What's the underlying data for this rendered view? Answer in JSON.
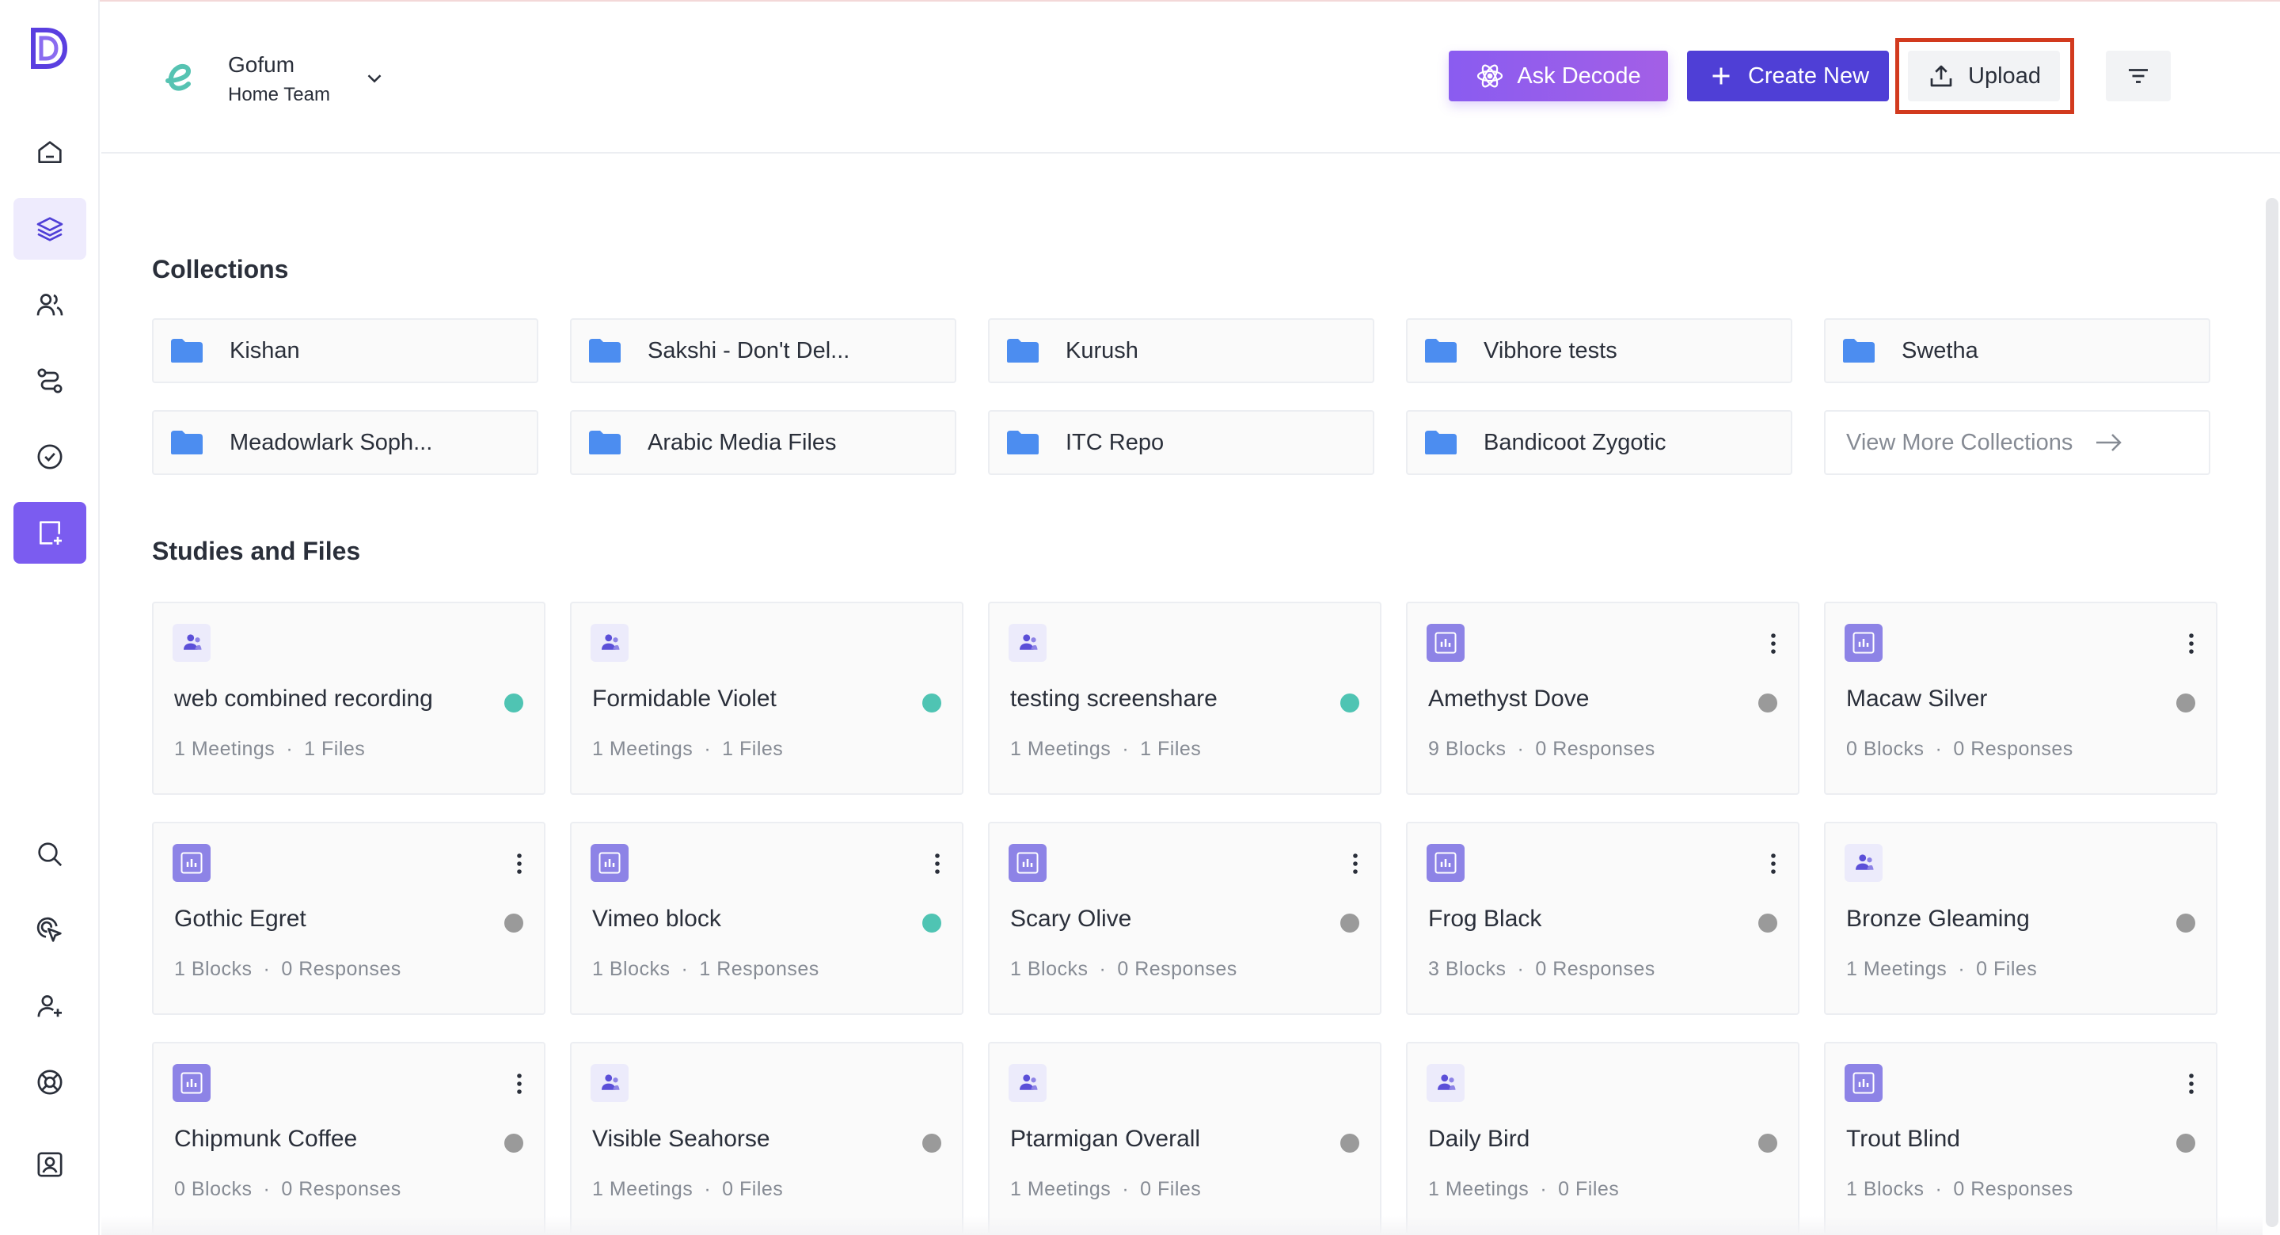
{
  "colors": {
    "accent": "#7b5cf0",
    "create": "#4f3fd6",
    "highlight": "#d23a1e",
    "status_active": "#4fc4b3",
    "status_inactive": "#9a9a9a",
    "folder": "#4c8df0"
  },
  "sidebar": {
    "logo_icon": "decode-logo-icon",
    "items": [
      {
        "icon": "home-icon"
      },
      {
        "icon": "layers-icon"
      },
      {
        "icon": "users-icon"
      },
      {
        "icon": "route-icon"
      },
      {
        "icon": "check-badge-icon"
      },
      {
        "icon": "add-file-icon"
      },
      {
        "icon": "search-icon"
      },
      {
        "icon": "pointer-click-icon"
      },
      {
        "icon": "add-user-icon"
      },
      {
        "icon": "lifebuoy-icon"
      },
      {
        "icon": "profile-icon"
      }
    ]
  },
  "header": {
    "team_name": "Gofum",
    "team_sub": "Home Team",
    "ask_label": "Ask Decode",
    "create_label": "Create New",
    "upload_label": "Upload"
  },
  "collections": {
    "title": "Collections",
    "items": [
      {
        "name": "Kishan"
      },
      {
        "name": "Sakshi - Don't Del..."
      },
      {
        "name": "Kurush"
      },
      {
        "name": "Vibhore tests"
      },
      {
        "name": "Swetha"
      },
      {
        "name": "Meadowlark Soph..."
      },
      {
        "name": "Arabic Media Files"
      },
      {
        "name": "ITC Repo"
      },
      {
        "name": "Bandicoot Zygotic"
      }
    ],
    "view_more": "View More Collections"
  },
  "studies": {
    "title": "Studies and Files",
    "items": [
      {
        "name": "web combined recording",
        "type": "study",
        "status": "active",
        "a": "1",
        "a_label": "Meetings",
        "b": "1",
        "b_label": "Files",
        "menu": false
      },
      {
        "name": "Formidable Violet",
        "type": "study",
        "status": "active",
        "a": "1",
        "a_label": "Meetings",
        "b": "1",
        "b_label": "Files",
        "menu": false
      },
      {
        "name": "testing screenshare",
        "type": "study",
        "status": "active",
        "a": "1",
        "a_label": "Meetings",
        "b": "1",
        "b_label": "Files",
        "menu": false
      },
      {
        "name": "Amethyst Dove",
        "type": "file",
        "status": "inactive",
        "a": "9",
        "a_label": "Blocks",
        "b": "0",
        "b_label": "Responses",
        "menu": true
      },
      {
        "name": "Macaw Silver",
        "type": "file",
        "status": "inactive",
        "a": "0",
        "a_label": "Blocks",
        "b": "0",
        "b_label": "Responses",
        "menu": true
      },
      {
        "name": "Gothic Egret",
        "type": "file",
        "status": "inactive",
        "a": "1",
        "a_label": "Blocks",
        "b": "0",
        "b_label": "Responses",
        "menu": true
      },
      {
        "name": "Vimeo block",
        "type": "file",
        "status": "active",
        "a": "1",
        "a_label": "Blocks",
        "b": "1",
        "b_label": "Responses",
        "menu": true
      },
      {
        "name": "Scary Olive",
        "type": "file",
        "status": "inactive",
        "a": "1",
        "a_label": "Blocks",
        "b": "0",
        "b_label": "Responses",
        "menu": true
      },
      {
        "name": "Frog Black",
        "type": "file",
        "status": "inactive",
        "a": "3",
        "a_label": "Blocks",
        "b": "0",
        "b_label": "Responses",
        "menu": true
      },
      {
        "name": "Bronze Gleaming",
        "type": "study",
        "status": "inactive",
        "a": "1",
        "a_label": "Meetings",
        "b": "0",
        "b_label": "Files",
        "menu": false
      },
      {
        "name": "Chipmunk Coffee",
        "type": "file",
        "status": "inactive",
        "a": "0",
        "a_label": "Blocks",
        "b": "0",
        "b_label": "Responses",
        "menu": true
      },
      {
        "name": "Visible Seahorse",
        "type": "study",
        "status": "inactive",
        "a": "1",
        "a_label": "Meetings",
        "b": "0",
        "b_label": "Files",
        "menu": false
      },
      {
        "name": "Ptarmigan Overall",
        "type": "study",
        "status": "inactive",
        "a": "1",
        "a_label": "Meetings",
        "b": "0",
        "b_label": "Files",
        "menu": false
      },
      {
        "name": "Daily Bird",
        "type": "study",
        "status": "inactive",
        "a": "1",
        "a_label": "Meetings",
        "b": "0",
        "b_label": "Files",
        "menu": false
      },
      {
        "name": "Trout Blind",
        "type": "file",
        "status": "inactive",
        "a": "1",
        "a_label": "Blocks",
        "b": "0",
        "b_label": "Responses",
        "menu": true
      }
    ]
  }
}
